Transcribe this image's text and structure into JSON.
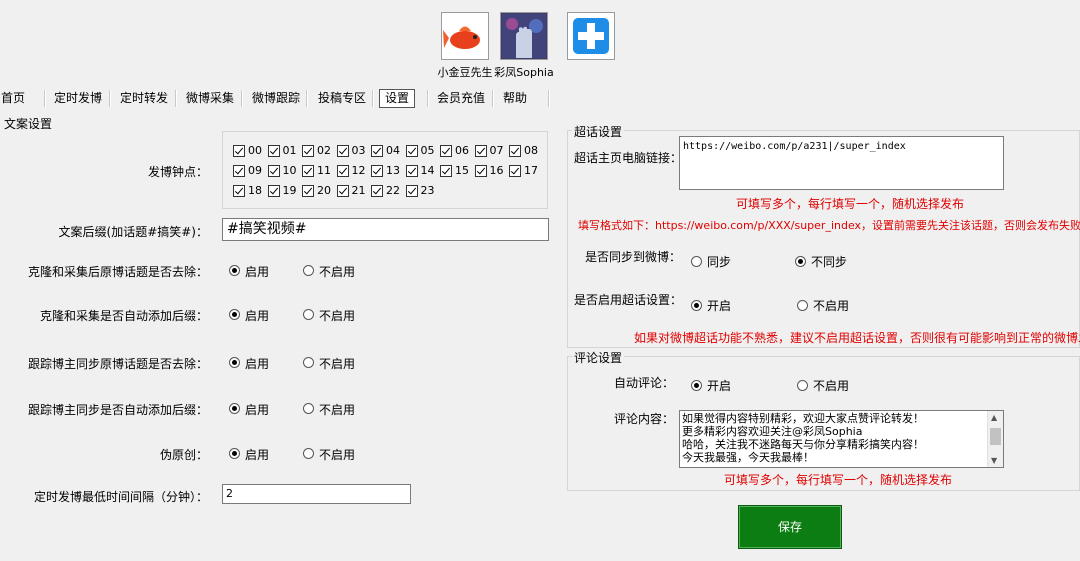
{
  "accounts": [
    {
      "name": "小金豆先生",
      "icon": "goldfish-avatar"
    },
    {
      "name": "彩凤Sophia",
      "icon": "hand-avatar"
    },
    {
      "name": "",
      "icon": "plus-icon"
    }
  ],
  "nav": {
    "items": [
      "首页",
      "定时发博",
      "定时转发",
      "微博采集",
      "微博跟踪",
      "投稿专区",
      "设置",
      "会员充值",
      "帮助"
    ],
    "active": "设置"
  },
  "left": {
    "group_title": "文案设置",
    "hours_label": "发博钟点：",
    "hours": [
      "00",
      "01",
      "02",
      "03",
      "04",
      "05",
      "06",
      "07",
      "08",
      "09",
      "10",
      "11",
      "12",
      "13",
      "14",
      "15",
      "16",
      "17",
      "18",
      "19",
      "20",
      "21",
      "22",
      "23"
    ],
    "suffix_label": "文案后缀(加话题#搞笑#)：",
    "suffix_value": "#搞笑视频#",
    "options": [
      {
        "label": "克隆和采集后原博话题是否去除：",
        "on": "启用",
        "off": "不启用",
        "selected": "on"
      },
      {
        "label": "克隆和采集是否自动添加后缀：",
        "on": "启用",
        "off": "不启用",
        "selected": "on"
      },
      {
        "label": "跟踪博主同步原博话题是否去除：",
        "on": "启用",
        "off": "不启用",
        "selected": "on"
      },
      {
        "label": "跟踪博主同步是否自动添加后缀：",
        "on": "启用",
        "off": "不启用",
        "selected": "on"
      },
      {
        "label": "伪原创：",
        "on": "启用",
        "off": "不启用",
        "selected": "on"
      }
    ],
    "interval_label": "定时发博最低时间间隔（分钟）：",
    "interval_value": "2"
  },
  "chaohua": {
    "group_title": "超话设置",
    "link_label": "超话主页电脑链接：",
    "link_value": "https://weibo.com/p/a231|/super_index",
    "hint1": "可填写多个，每行填写一个，随机选择发布",
    "hint2": "填写格式如下：https://weibo.com/p/XXX/super_index，设置前需要先关注该话题，否则会发布失败",
    "sync_label": "是否同步到微博：",
    "sync_opt1": "同步",
    "sync_opt2": "不同步",
    "sync_selected": "不同步",
    "enable_label": "是否启用超话设置：",
    "enable_on": "开启",
    "enable_off": "不启用",
    "enable_selected": "开启",
    "warning": "如果对微博超话功能不熟悉，建议不启用超话设置，否则很有可能影响到正常的微博发布！"
  },
  "comment": {
    "group_title": "评论设置",
    "auto_label": "自动评论：",
    "auto_on": "开启",
    "auto_off": "不启用",
    "auto_selected": "开启",
    "content_label": "评论内容：",
    "lines": [
      "如果觉得内容特别精彩，欢迎大家点赞评论转发！",
      "更多精彩内容欢迎关注@彩凤Sophia",
      "哈哈，关注我不迷路每天与你分享精彩搞笑内容！",
      "今天我最强，今天我最棒！"
    ],
    "hint": "可填写多个，每行填写一个，随机选择发布"
  },
  "save_label": "保存",
  "colors": {
    "save_bg": "#0b7d12",
    "red": "#e00000",
    "window": "#f0f0f0"
  }
}
